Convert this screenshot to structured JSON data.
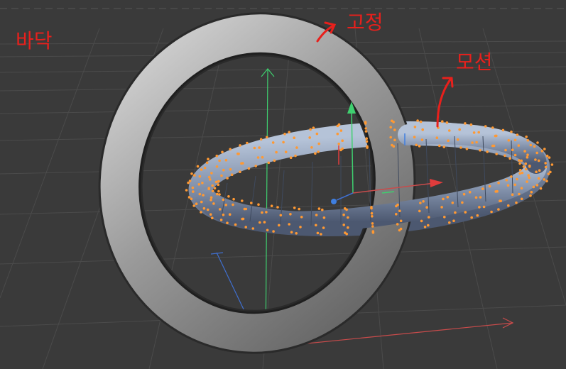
{
  "viewport": {
    "background": "#3a3a3a",
    "grid_color": "#4a4a4a",
    "axis_colors": {
      "x": "#c94b4b",
      "y": "#3fcf6f",
      "z": "#3f6fd0"
    }
  },
  "objects": {
    "fixed_ring": {
      "color": "#9c9c9c"
    },
    "motion_torus": {
      "color": "#8a9bb5",
      "selection_color": "#ff9933"
    }
  },
  "annotations": {
    "outside": "바닥",
    "fixed": "고정",
    "motion": "모션"
  }
}
